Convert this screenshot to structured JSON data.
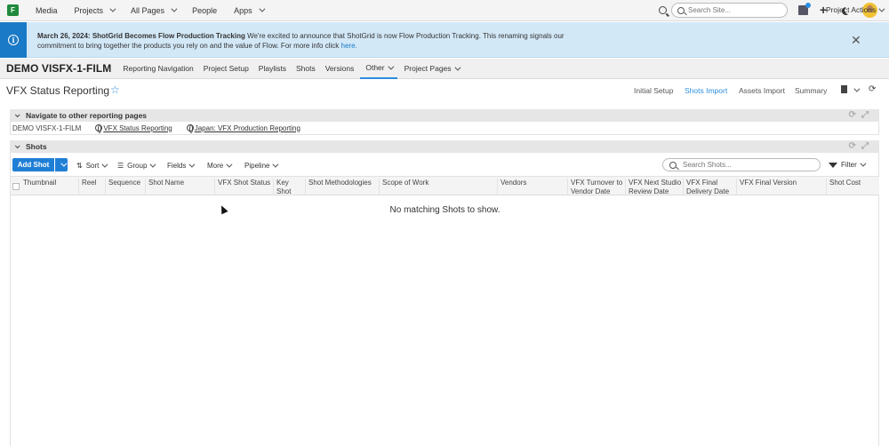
{
  "topnav": {
    "logo": "F",
    "items": [
      {
        "label": "Media",
        "dropdown": false
      },
      {
        "label": "Projects",
        "dropdown": true
      },
      {
        "label": "All Pages",
        "dropdown": true
      },
      {
        "label": "People",
        "dropdown": false
      },
      {
        "label": "Apps",
        "dropdown": true
      }
    ],
    "search_placeholder": "Search Site..."
  },
  "banner": {
    "title": "March 26, 2024: ShotGrid Becomes Flow Production Tracking",
    "body": " We're excited to announce that ShotGrid is now Flow Production Tracking. This renaming signals our commitment to bring together the products you rely on and the value of Flow. For more info click ",
    "link": "here."
  },
  "project": {
    "name": "DEMO VISFX-1-FILM",
    "tabs": [
      {
        "label": "Reporting Navigation",
        "dropdown": false
      },
      {
        "label": "Project Setup",
        "dropdown": false
      },
      {
        "label": "Playlists",
        "dropdown": false
      },
      {
        "label": "Shots",
        "dropdown": false
      },
      {
        "label": "Versions",
        "dropdown": false
      },
      {
        "label": "Other",
        "dropdown": true
      },
      {
        "label": "Project Pages",
        "dropdown": true
      }
    ],
    "actions_label": "Project Actions"
  },
  "page": {
    "title": "VFX Status Reporting",
    "star": "☆",
    "tabs": [
      "Initial Setup",
      "Shots Import",
      "Assets Import",
      "Summary"
    ],
    "active_tab": "Shots Import"
  },
  "navigate_section": {
    "title": "Navigate to other reporting pages",
    "plain": "DEMO VISFX-1-FILM",
    "links": [
      "VFX Status Reporting",
      "Japan: VFX Production Reporting"
    ]
  },
  "shots_section": {
    "title": "Shots",
    "add_label": "Add Shot",
    "toolbar": [
      "Sort",
      "Group",
      "Fields",
      "More",
      "Pipeline"
    ],
    "search_placeholder": "Search Shots...",
    "filter_label": "Filter",
    "columns": [
      "Thumbnail",
      "Reel",
      "Sequence",
      "Shot Name",
      "VFX Shot Status",
      "Key Shot",
      "Shot Methodologies",
      "Scope of Work",
      "Vendors",
      "VFX Turnover to Vendor Date",
      "VFX Next Studio Review Date",
      "VFX Final Delivery Date",
      "VFX Final Version",
      "Shot Cost"
    ],
    "empty_message": "No matching Shots to show."
  },
  "colors": {
    "accent": "#2c8ee0",
    "button": "#1f7fd6",
    "banner_bg": "#d3e8f7",
    "logo": "#1f8a3e"
  }
}
